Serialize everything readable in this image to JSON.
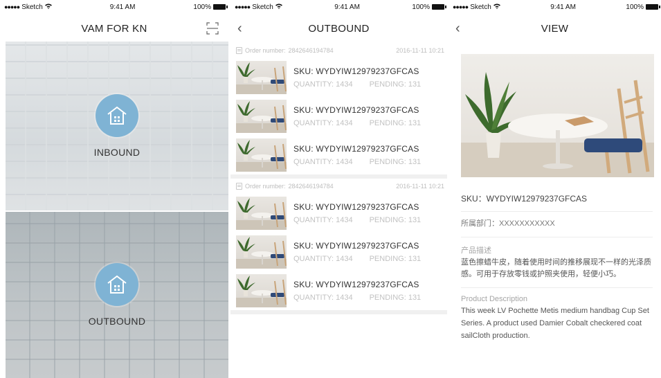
{
  "status": {
    "carrier": "Sketch",
    "time": "9:41 AM",
    "battery": "100%"
  },
  "home": {
    "title": "VAM FOR KN",
    "inbound_label": "INBOUND",
    "outbound_label": "OUTBOUND",
    "icons": [
      "scan-icon",
      "warehouse-icon"
    ]
  },
  "outbound": {
    "title": "OUTBOUND",
    "orders": [
      {
        "order_label": "Order number:",
        "order_number": "2842646194784",
        "datetime": "2016-11-11 10:21",
        "items": [
          {
            "sku": "SKU: WYDYIW12979237GFCAS",
            "quantity": "QUANTITY: 1434",
            "pending": "PENDING: 131"
          },
          {
            "sku": "SKU: WYDYIW12979237GFCAS",
            "quantity": "QUANTITY: 1434",
            "pending": "PENDING: 131"
          },
          {
            "sku": "SKU: WYDYIW12979237GFCAS",
            "quantity": "QUANTITY: 1434",
            "pending": "PENDING: 131"
          }
        ]
      },
      {
        "order_label": "Order number:",
        "order_number": "2842646194784",
        "datetime": "2016-11-11 10:21",
        "items": [
          {
            "sku": "SKU: WYDYIW12979237GFCAS",
            "quantity": "QUANTITY: 1434",
            "pending": "PENDING: 131"
          },
          {
            "sku": "SKU: WYDYIW12979237GFCAS",
            "quantity": "QUANTITY: 1434",
            "pending": "PENDING: 131"
          },
          {
            "sku": "SKU: WYDYIW12979237GFCAS",
            "quantity": "QUANTITY: 1434",
            "pending": "PENDING: 131"
          }
        ]
      }
    ]
  },
  "view": {
    "title": "VIEW",
    "sku": "SKU：WYDYIW12979237GFCAS",
    "department": "所属部门：XXXXXXXXXXX",
    "cn_title": "产品描述",
    "cn_body": "蓝色擦蜡牛皮，随着使用时间的推移展现不一样的光泽质感。可用于存放零钱或护照夹使用，轻便小巧。",
    "en_title": "Product Description",
    "en_body": "This week LV Pochette Metis medium handbag Cup Set Series. A product used Damier Cobalt checkered coat sailCloth production."
  },
  "colors": {
    "accent_icon": "#7fb3d4",
    "muted_text": "#c2c2c2",
    "separator": "#f0f0f0"
  }
}
